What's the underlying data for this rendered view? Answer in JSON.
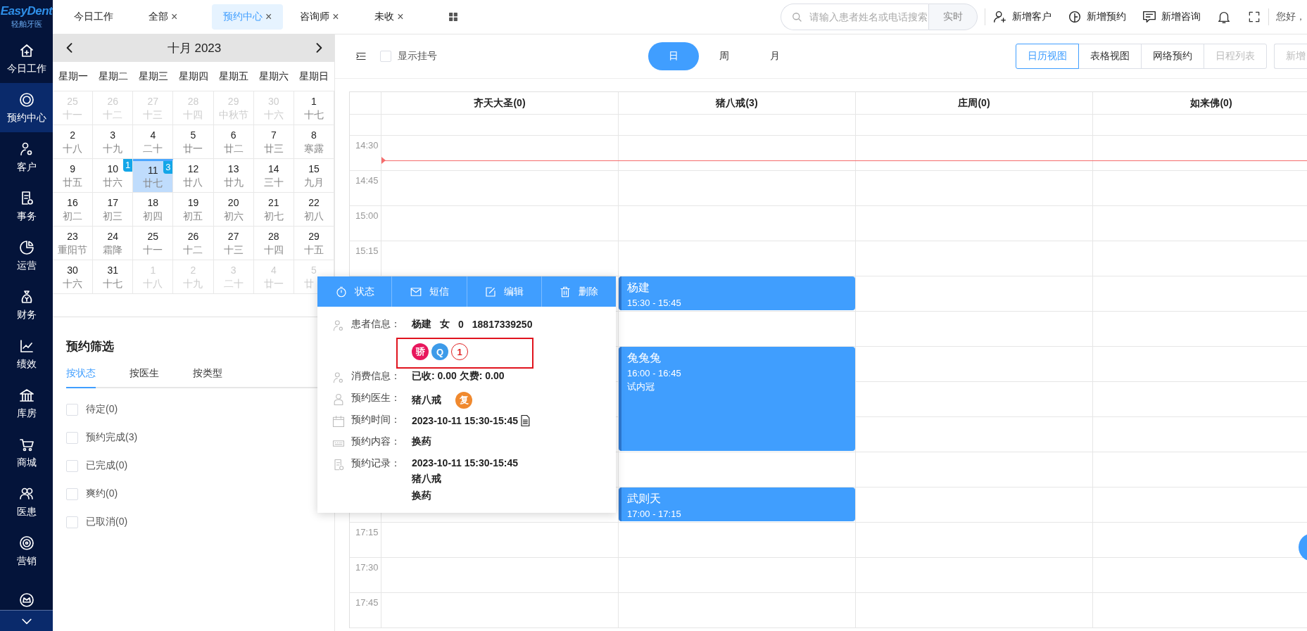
{
  "sidebar": {
    "logo": {
      "brand": "EasyDent",
      "subtitle": "轻舶牙医"
    },
    "items": [
      {
        "label": "今日工作",
        "kind": "home",
        "selected": false
      },
      {
        "label": "预约中心",
        "kind": "ring",
        "selected": true
      },
      {
        "label": "客户",
        "kind": "person",
        "selected": false
      },
      {
        "label": "事务",
        "kind": "document",
        "selected": false
      },
      {
        "label": "运营",
        "kind": "pie",
        "selected": false
      },
      {
        "label": "财务",
        "kind": "moneybag",
        "selected": false
      },
      {
        "label": "绩效",
        "kind": "chart",
        "selected": false
      },
      {
        "label": "库房",
        "kind": "bank",
        "selected": false
      },
      {
        "label": "商城",
        "kind": "cart",
        "selected": false
      },
      {
        "label": "医患",
        "kind": "people",
        "selected": false
      },
      {
        "label": "营销",
        "kind": "target",
        "selected": false
      },
      {
        "kind": "crown",
        "selected": false
      }
    ]
  },
  "topbar": {
    "tabs": [
      {
        "label": "今日工作",
        "selected": false
      },
      {
        "label": "全部",
        "close": "×",
        "selected": false
      },
      {
        "label": "预约中心",
        "close": "×",
        "selected": true
      },
      {
        "label": "咨询师",
        "close": "×",
        "selected": false
      },
      {
        "label": "未收",
        "close": "×",
        "selected": false
      }
    ],
    "search": {
      "placeholder": "请输入患者姓名或电话搜索",
      "button": "实时"
    },
    "actions": [
      {
        "label": "新增客户",
        "kind": "person-plus"
      },
      {
        "label": "新增预约",
        "kind": "clock-plus"
      },
      {
        "label": "新增咨询",
        "kind": "chat"
      }
    ],
    "greeting": "您好，"
  },
  "calendar": {
    "title": "十月 2023",
    "weekdays": [
      "星期一",
      "星期二",
      "星期三",
      "星期四",
      "星期五",
      "星期六",
      "星期日"
    ],
    "weeks": [
      [
        {
          "day": "25",
          "lunar": "十一",
          "outside": true,
          "selected": false
        },
        {
          "day": "26",
          "lunar": "十二",
          "outside": true,
          "selected": false
        },
        {
          "day": "27",
          "lunar": "十三",
          "outside": true,
          "selected": false
        },
        {
          "day": "28",
          "lunar": "十四",
          "outside": true,
          "selected": false
        },
        {
          "day": "29",
          "lunar": "中秋节",
          "outside": true,
          "selected": false
        },
        {
          "day": "30",
          "lunar": "十六",
          "outside": true,
          "selected": false
        },
        {
          "day": "1",
          "lunar": "十七",
          "outside": false,
          "selected": false
        }
      ],
      [
        {
          "day": "2",
          "lunar": "十八",
          "outside": false,
          "selected": false
        },
        {
          "day": "3",
          "lunar": "十九",
          "outside": false,
          "selected": false
        },
        {
          "day": "4",
          "lunar": "二十",
          "outside": false,
          "selected": false
        },
        {
          "day": "5",
          "lunar": "廿一",
          "outside": false,
          "selected": false
        },
        {
          "day": "6",
          "lunar": "廿二",
          "outside": false,
          "selected": false
        },
        {
          "day": "7",
          "lunar": "廿三",
          "outside": false,
          "selected": false
        },
        {
          "day": "8",
          "lunar": "寒露",
          "outside": false,
          "selected": false
        }
      ],
      [
        {
          "day": "9",
          "lunar": "廿五",
          "outside": false,
          "selected": false
        },
        {
          "day": "10",
          "lunar": "廿六",
          "outside": false,
          "selected": false,
          "badge": "1"
        },
        {
          "day": "11",
          "lunar": "廿七",
          "outside": false,
          "selected": true,
          "badge": "3"
        },
        {
          "day": "12",
          "lunar": "廿八",
          "outside": false,
          "selected": false
        },
        {
          "day": "13",
          "lunar": "廿九",
          "outside": false,
          "selected": false
        },
        {
          "day": "14",
          "lunar": "三十",
          "outside": false,
          "selected": false
        },
        {
          "day": "15",
          "lunar": "九月",
          "outside": false,
          "selected": false
        }
      ],
      [
        {
          "day": "16",
          "lunar": "初二",
          "outside": false,
          "selected": false
        },
        {
          "day": "17",
          "lunar": "初三",
          "outside": false,
          "selected": false
        },
        {
          "day": "18",
          "lunar": "初四",
          "outside": false,
          "selected": false
        },
        {
          "day": "19",
          "lunar": "初五",
          "outside": false,
          "selected": false
        },
        {
          "day": "20",
          "lunar": "初六",
          "outside": false,
          "selected": false
        },
        {
          "day": "21",
          "lunar": "初七",
          "outside": false,
          "selected": false
        },
        {
          "day": "22",
          "lunar": "初八",
          "outside": false,
          "selected": false
        }
      ],
      [
        {
          "day": "23",
          "lunar": "重阳节",
          "outside": false,
          "selected": false
        },
        {
          "day": "24",
          "lunar": "霜降",
          "outside": false,
          "selected": false
        },
        {
          "day": "25",
          "lunar": "十一",
          "outside": false,
          "selected": false
        },
        {
          "day": "26",
          "lunar": "十二",
          "outside": false,
          "selected": false
        },
        {
          "day": "27",
          "lunar": "十三",
          "outside": false,
          "selected": false
        },
        {
          "day": "28",
          "lunar": "十四",
          "outside": false,
          "selected": false
        },
        {
          "day": "29",
          "lunar": "十五",
          "outside": false,
          "selected": false
        }
      ],
      [
        {
          "day": "30",
          "lunar": "十六",
          "outside": false,
          "selected": false
        },
        {
          "day": "31",
          "lunar": "十七",
          "outside": false,
          "selected": false
        },
        {
          "day": "1",
          "lunar": "十八",
          "outside": true,
          "selected": false
        },
        {
          "day": "2",
          "lunar": "十九",
          "outside": true,
          "selected": false
        },
        {
          "day": "3",
          "lunar": "二十",
          "outside": true,
          "selected": false
        },
        {
          "day": "4",
          "lunar": "廿一",
          "outside": true,
          "selected": false
        },
        {
          "day": "5",
          "lunar": "廿",
          "outside": true,
          "selected": false
        }
      ]
    ]
  },
  "filter": {
    "title": "预约筛选",
    "tabs": [
      {
        "label": "按状态",
        "selected": true
      },
      {
        "label": "按医生",
        "selected": false
      },
      {
        "label": "按类型",
        "selected": false
      }
    ],
    "options": [
      {
        "label": "待定(0)",
        "checked": false
      },
      {
        "label": "预约完成(3)",
        "checked": false
      },
      {
        "label": "已完成(0)",
        "checked": false
      },
      {
        "label": "爽约(0)",
        "checked": false
      },
      {
        "label": "已取消(0)",
        "checked": false
      }
    ]
  },
  "schedule": {
    "toggle": {
      "label": "显示挂号",
      "checked": false
    },
    "ranges": [
      {
        "label": "日",
        "selected": true
      },
      {
        "label": "周",
        "selected": false
      },
      {
        "label": "月",
        "selected": false
      }
    ],
    "views": [
      {
        "label": "日历视图",
        "selected": true,
        "disabled": false
      },
      {
        "label": "表格视图",
        "selected": false,
        "disabled": false
      },
      {
        "label": "网络预约",
        "selected": false,
        "disabled": false
      },
      {
        "label": "日程列表",
        "selected": false,
        "disabled": true
      }
    ],
    "new_button": "新增",
    "columns": [
      {
        "name": "齐天大圣(0)"
      },
      {
        "name": "猪八戒(3)",
        "appointments": [
          {
            "patient": "杨建",
            "time": "15:30 - 15:45"
          },
          {
            "patient": "兔兔兔",
            "time": "16:00 - 16:45",
            "note": "试内冠"
          },
          {
            "patient": "武则天",
            "time": "17:00 - 17:15"
          }
        ]
      },
      {
        "name": "庄周(0)"
      },
      {
        "name": "如来佛(0)"
      }
    ],
    "time_labels": [
      "14:30",
      "14:45",
      "15:00",
      "15:15",
      "17:15",
      "17:30",
      "17:45"
    ]
  },
  "popup": {
    "actions": [
      {
        "label": "状态",
        "kind": "timer"
      },
      {
        "label": "短信",
        "kind": "mail"
      },
      {
        "label": "编辑",
        "kind": "edit"
      },
      {
        "label": "删除",
        "kind": "trash"
      }
    ],
    "rows": [
      {
        "kind": "person",
        "label": "患者信息：",
        "values": [
          "杨建",
          "女",
          "0",
          "18817339250"
        ],
        "highlighted": true,
        "tags": [
          {
            "text": "骄",
            "color": "#e8175d",
            "outline": false
          },
          {
            "text": "Q",
            "color": "#3d9be9",
            "outline": false
          },
          {
            "text": "1",
            "color": "#e02020",
            "outline": true
          }
        ]
      },
      {
        "kind": "person",
        "label": "消费信息：",
        "values": [
          "已收: 0.00 欠费: 0.00"
        ]
      },
      {
        "kind": "doctor",
        "label": "预约医生：",
        "values": [
          "猪八戒"
        ],
        "tags": [
          {
            "text": "复",
            "color": "#f0892e",
            "outline": false
          }
        ]
      },
      {
        "kind": "calendar",
        "label": "预约时间：",
        "values": [
          "2023-10-11 15:30-15:45"
        ],
        "attachment": true
      },
      {
        "kind": "keyboard",
        "label": "预约内容：",
        "values": [
          "换药"
        ]
      },
      {
        "kind": "document",
        "label": "预约记录：",
        "lines": [
          "2023-10-11 15:30-15:45",
          "猪八戒",
          "换药"
        ]
      }
    ]
  }
}
